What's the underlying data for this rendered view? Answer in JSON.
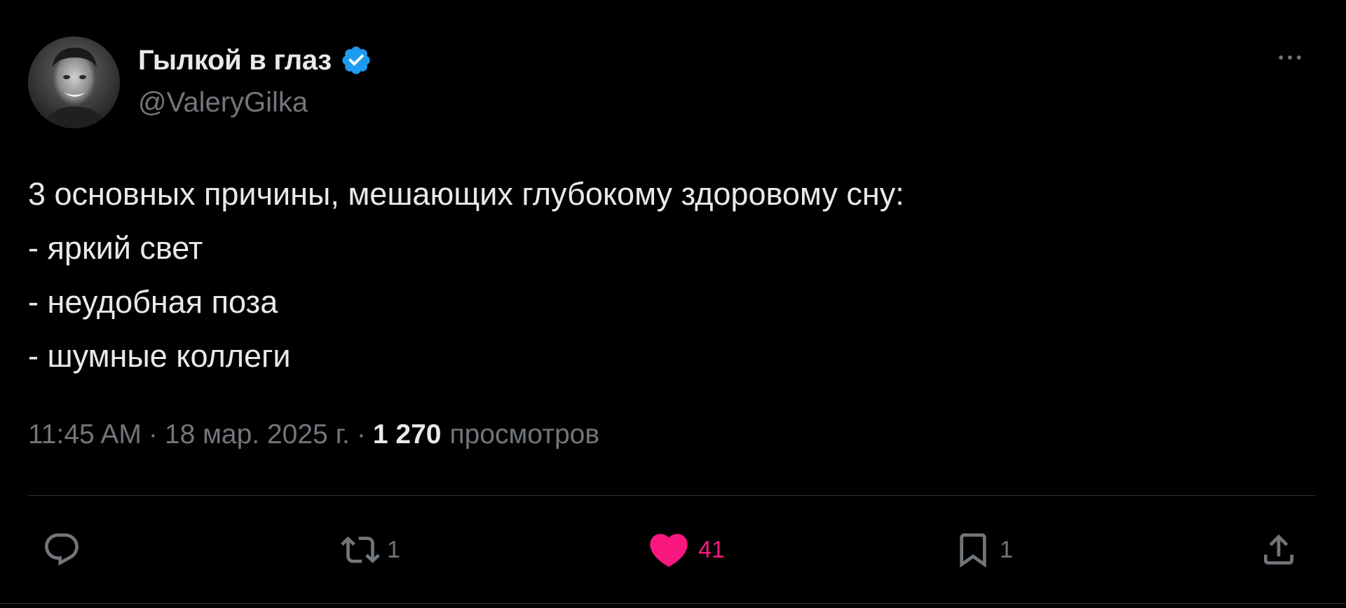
{
  "author": {
    "name": "Гылкой в глаз",
    "handle": "@ValeryGilka",
    "verified": true,
    "verified_color": "#1d9bf0"
  },
  "header": {
    "more_icon": "more-horizontal-icon"
  },
  "tweet": {
    "lines": [
      "3 основных причины, мешающих глубокому здоровому сну:",
      "- яркий свет",
      "- неудобная поза",
      "- шумные коллеги"
    ]
  },
  "meta": {
    "time": "11:45 AM",
    "separator": "·",
    "date": "18 мар. 2025 г.",
    "views_count": "1 270",
    "views_label": "просмотров"
  },
  "actions": {
    "reply": {
      "icon": "reply-icon",
      "count": ""
    },
    "retweet": {
      "icon": "retweet-icon",
      "count": "1"
    },
    "like": {
      "icon": "heart-icon",
      "count": "41",
      "active": true,
      "color": "#f91880"
    },
    "bookmark": {
      "icon": "bookmark-icon",
      "count": "1"
    },
    "share": {
      "icon": "share-icon",
      "count": ""
    }
  },
  "colors": {
    "background": "#000000",
    "text_primary": "#e7e9ea",
    "text_secondary": "#71767b",
    "divider": "#2f3336"
  }
}
